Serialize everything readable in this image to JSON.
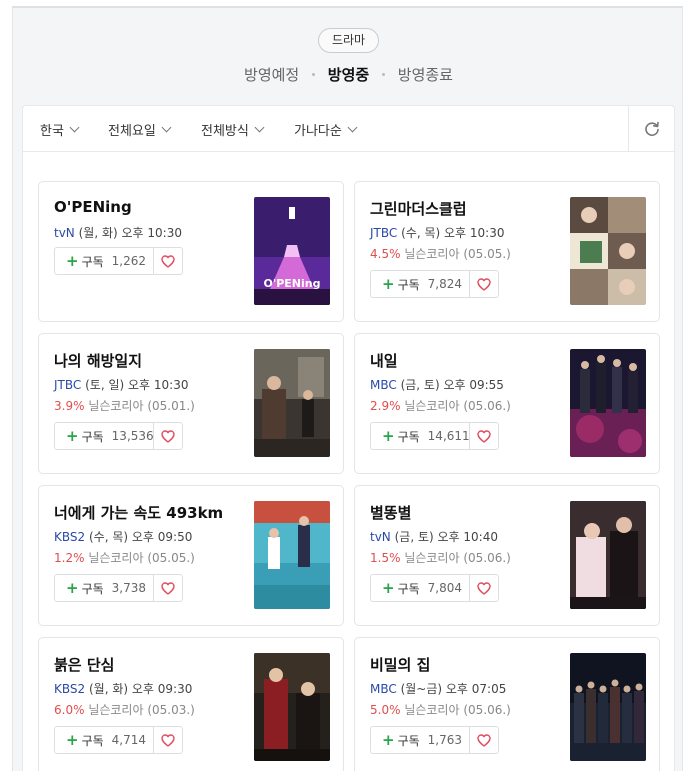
{
  "header": {
    "category_badge": "드라마",
    "tabs": [
      {
        "label": "방영예정",
        "active": false
      },
      {
        "label": "방영중",
        "active": true
      },
      {
        "label": "방영종료",
        "active": false
      }
    ]
  },
  "filters": {
    "country": "한국",
    "day": "전체요일",
    "method": "전체방식",
    "sort": "가나다순",
    "refresh_icon": "refresh-icon"
  },
  "colors": {
    "channel": "#2a4aa8",
    "rating": "#e04e4e",
    "plus": "#2aa34a",
    "heart": "#e04e60"
  },
  "subscribe_label": "구독",
  "dramas": [
    {
      "title": "O'PENing",
      "channel": "tvN",
      "schedule": " (월, 화) 오후 10:30",
      "rating": "",
      "rating_source": "",
      "subscribers": "1,262"
    },
    {
      "title": "그린마더스클럽",
      "channel": "JTBC",
      "schedule": " (수, 목) 오후 10:30",
      "rating": "4.5%",
      "rating_source": " 닐슨코리아 (05.05.)",
      "subscribers": "7,824"
    },
    {
      "title": "나의 해방일지",
      "channel": "JTBC",
      "schedule": " (토, 일) 오후 10:30",
      "rating": "3.9%",
      "rating_source": " 닐슨코리아 (05.01.)",
      "subscribers": "13,536"
    },
    {
      "title": "내일",
      "channel": "MBC",
      "schedule": " (금, 토) 오후 09:55",
      "rating": "2.9%",
      "rating_source": " 닐슨코리아 (05.06.)",
      "subscribers": "14,611"
    },
    {
      "title": "너에게 가는 속도 493km",
      "channel": "KBS2",
      "schedule": " (수, 목) 오후 09:50",
      "rating": "1.2%",
      "rating_source": " 닐슨코리아 (05.05.)",
      "subscribers": "3,738"
    },
    {
      "title": "별똥별",
      "channel": "tvN",
      "schedule": " (금, 토) 오후 10:40",
      "rating": "1.5%",
      "rating_source": " 닐슨코리아 (05.06.)",
      "subscribers": "7,804"
    },
    {
      "title": "붉은 단심",
      "channel": "KBS2",
      "schedule": " (월, 화) 오후 09:30",
      "rating": "6.0%",
      "rating_source": " 닐슨코리아 (05.03.)",
      "subscribers": "4,714"
    },
    {
      "title": "비밀의 집",
      "channel": "MBC",
      "schedule": " (월~금) 오후 07:05",
      "rating": "5.0%",
      "rating_source": " 닐슨코리아 (05.06.)",
      "subscribers": "1,763"
    }
  ]
}
